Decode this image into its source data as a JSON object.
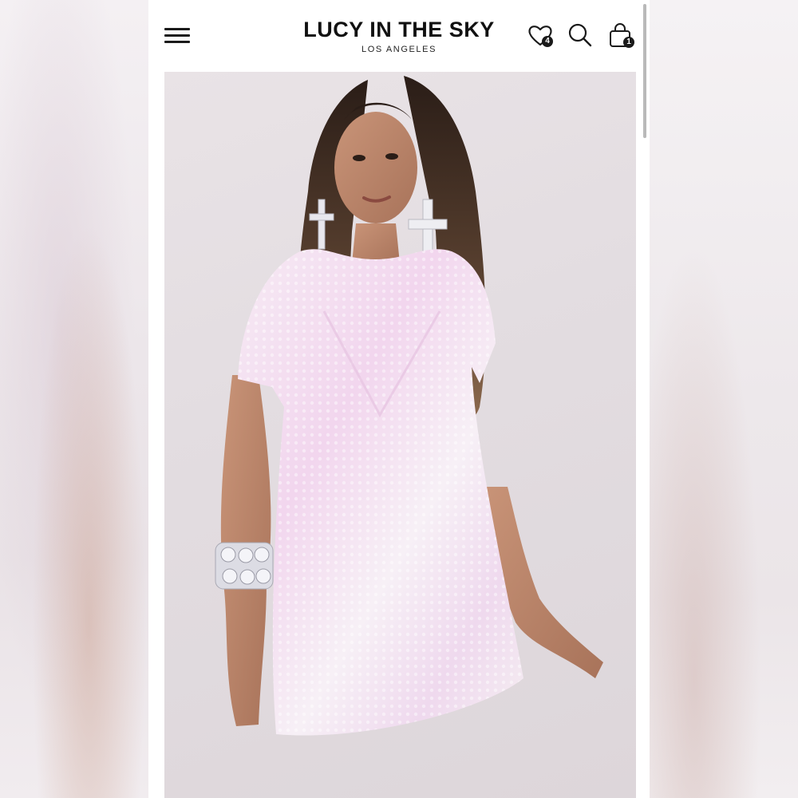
{
  "brand": {
    "name": "LUCY IN THE SKY",
    "subtitle": "LOS ANGELES"
  },
  "header": {
    "menu_icon": "hamburger-icon",
    "wishlist": {
      "icon": "heart-icon",
      "count": "4"
    },
    "search": {
      "icon": "search-icon"
    },
    "cart": {
      "icon": "shopping-bag-icon",
      "count": "1"
    }
  },
  "product": {
    "image": "model-wearing-iridescent-sequin-tshirt-dress"
  },
  "colors": {
    "text": "#111111",
    "badge": "#1a1a1a",
    "backdrop": "#ede8eb"
  }
}
